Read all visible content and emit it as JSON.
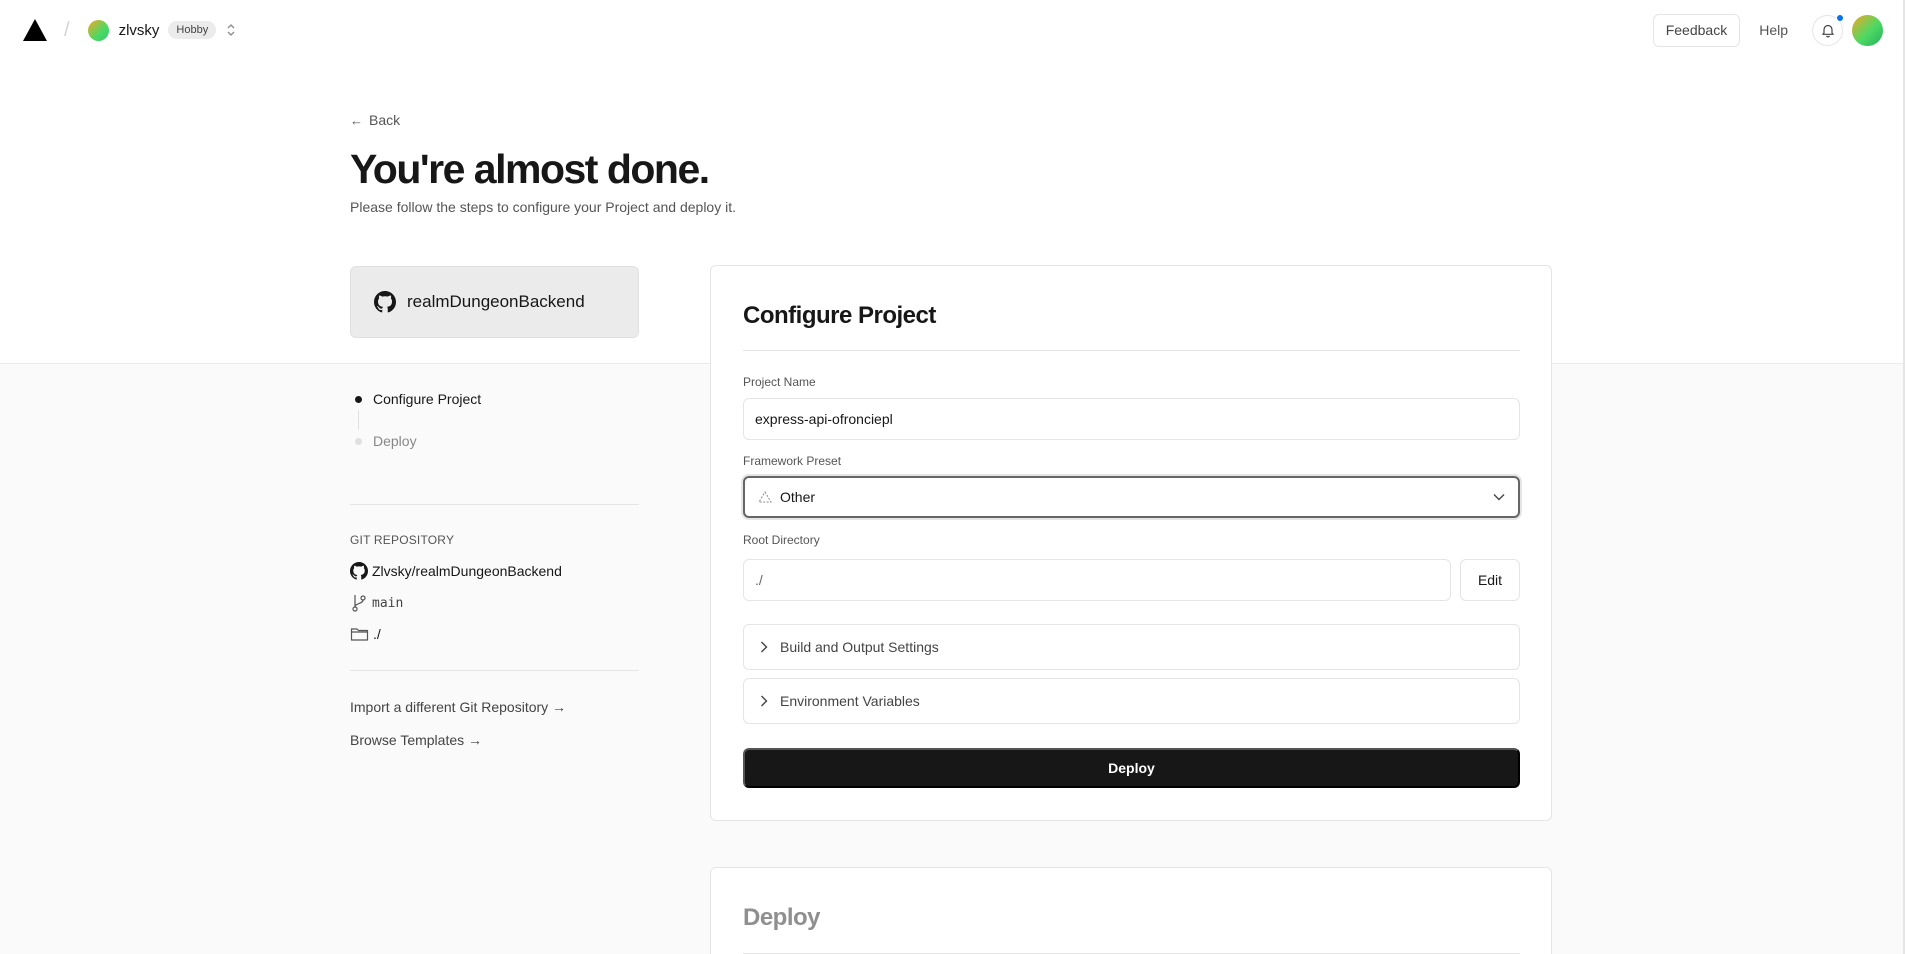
{
  "header": {
    "team_name": "zlvsky",
    "plan_badge": "Hobby",
    "feedback_label": "Feedback",
    "help_label": "Help"
  },
  "page": {
    "back_label": "Back",
    "title": "You're almost done.",
    "subtitle": "Please follow the steps to configure your Project and deploy it."
  },
  "sidebar": {
    "repo_card_name": "realmDungeonBackend",
    "steps": [
      {
        "label": "Configure Project",
        "active": true
      },
      {
        "label": "Deploy",
        "active": false
      }
    ],
    "git_label": "GIT REPOSITORY",
    "git_repo": "Zlvsky/realmDungeonBackend",
    "git_branch": "main",
    "git_dir": "./",
    "import_link": "Import a different Git Repository →",
    "templates_link": "Browse Templates →"
  },
  "configure": {
    "title": "Configure Project",
    "project_name_label": "Project Name",
    "project_name_value": "express-api-ofronciepl",
    "framework_label": "Framework Preset",
    "framework_value": "Other",
    "root_dir_label": "Root Directory",
    "root_dir_value": "./",
    "edit_label": "Edit",
    "build_settings_label": "Build and Output Settings",
    "env_vars_label": "Environment Variables",
    "deploy_label": "Deploy"
  },
  "deploy_section": {
    "title": "Deploy"
  },
  "icons": {
    "logo": "triangle-logo-icon",
    "github": "github-icon",
    "branch": "git-branch-icon",
    "folder": "folder-icon",
    "bell": "bell-icon",
    "framework": "triangle-outline-icon"
  },
  "colors": {
    "primary_button": "#171717",
    "notification_dot": "#0a72ef",
    "surface": "#ffffff",
    "background": "#fafafa"
  }
}
